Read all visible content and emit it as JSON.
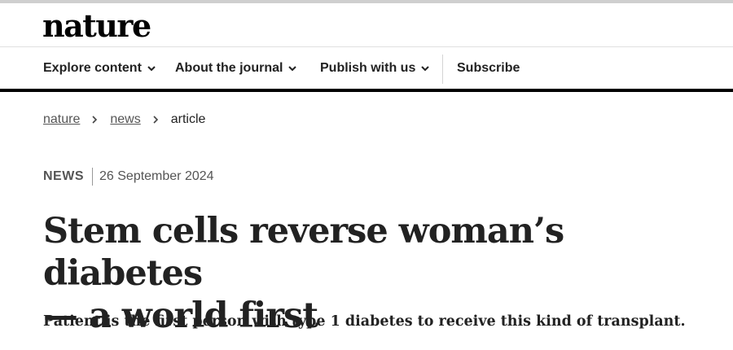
{
  "site": {
    "logo_text": "nature"
  },
  "nav": {
    "items": [
      {
        "label": "Explore content",
        "icon": "chevron-down-icon"
      },
      {
        "label": "About the journal",
        "icon": "chevron-down-icon"
      },
      {
        "label": "Publish with us",
        "icon": "chevron-down-icon"
      },
      {
        "label": "Subscribe"
      }
    ]
  },
  "breadcrumb": {
    "items": [
      "nature",
      "news",
      "article"
    ],
    "separator_icon": "chevron-right-icon"
  },
  "article": {
    "type": "NEWS",
    "date": "26 September 2024",
    "headline_line1": "Stem cells reverse woman’s diabetes",
    "headline_line2": "— a world first",
    "standfirst": "Patient is the first person with type 1 diabetes to receive this kind of transplant."
  },
  "colors": {
    "accent_bar": "#000000",
    "text": "#222222",
    "muted": "#555555"
  }
}
